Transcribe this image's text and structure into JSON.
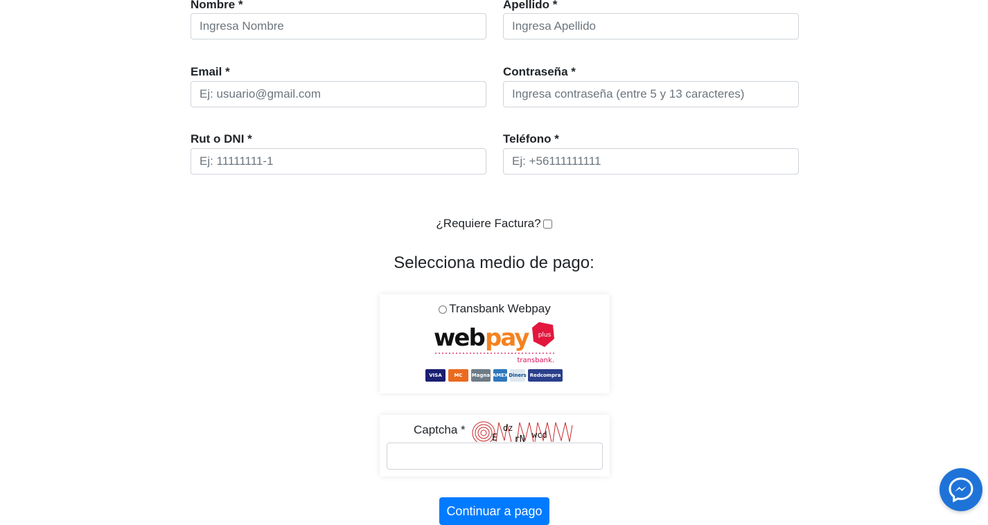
{
  "form": {
    "nombre": {
      "label": "Nombre *",
      "placeholder": "Ingresa Nombre"
    },
    "apellido": {
      "label": "Apellido *",
      "placeholder": "Ingresa Apellido"
    },
    "email": {
      "label": "Email *",
      "placeholder": "Ej: usuario@gmail.com"
    },
    "password": {
      "label": "Contraseña *",
      "placeholder": "Ingresa contraseña (entre 5 y 13 caracteres)"
    },
    "rut": {
      "label": "Rut o DNI *",
      "placeholder": "Ej: 11111111-1"
    },
    "telefono": {
      "label": "Teléfono *",
      "placeholder": "Ej: +56111111111"
    }
  },
  "factura": {
    "label": "¿Requiere Factura?",
    "checked": false
  },
  "payment": {
    "title": "Selecciona medio de pago:",
    "option_label": "Transbank Webpay",
    "logo": {
      "word_black": "web",
      "word_orange": "pay",
      "badge": "plus",
      "sub": "transbank."
    },
    "cards": [
      "VISA",
      "MC",
      "Magna",
      "AMEX",
      "Diners",
      "Redcompra"
    ]
  },
  "captcha": {
    "label": "Captcha *",
    "image_text": "E dz rNwcd"
  },
  "actions": {
    "continue_label": "Continuar a pago"
  },
  "colors": {
    "primary": "#007bff",
    "messenger": "#1f73d8",
    "webpay_orange": "#f58220",
    "transbank_pink": "#d3105a"
  },
  "icons": {
    "messenger": "messenger-icon"
  }
}
